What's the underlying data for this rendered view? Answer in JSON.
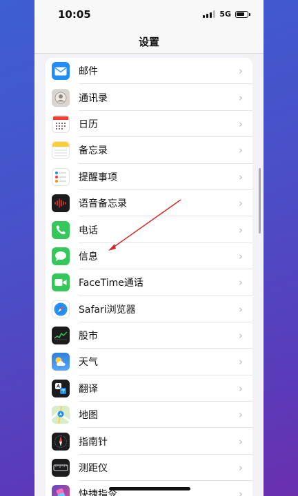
{
  "status_bar": {
    "time": "10:05",
    "network": "5G"
  },
  "nav": {
    "title": "设置"
  },
  "settings": {
    "items": [
      {
        "label": "邮件",
        "icon": "mail-icon",
        "color": "#1f8ef7"
      },
      {
        "label": "通讯录",
        "icon": "contacts-icon",
        "color": "#d9d6d1"
      },
      {
        "label": "日历",
        "icon": "calendar-icon",
        "color": "#ffffff"
      },
      {
        "label": "备忘录",
        "icon": "notes-icon",
        "color": "#ffcd35"
      },
      {
        "label": "提醒事项",
        "icon": "reminders-icon",
        "color": "#ffffff"
      },
      {
        "label": "语音备忘录",
        "icon": "voice-memos-icon",
        "color": "#1c1c1e"
      },
      {
        "label": "电话",
        "icon": "phone-icon",
        "color": "#34c759"
      },
      {
        "label": "信息",
        "icon": "messages-icon",
        "color": "#34c759"
      },
      {
        "label": "FaceTime通话",
        "icon": "facetime-icon",
        "color": "#34c759"
      },
      {
        "label": "Safari浏览器",
        "icon": "safari-icon",
        "color": "#1e8cf0"
      },
      {
        "label": "股市",
        "icon": "stocks-icon",
        "color": "#1c1c1e"
      },
      {
        "label": "天气",
        "icon": "weather-icon",
        "color": "#3a8ee6"
      },
      {
        "label": "翻译",
        "icon": "translate-icon",
        "color": "#1c1c1e"
      },
      {
        "label": "地图",
        "icon": "maps-icon",
        "color": "#e8f2e1"
      },
      {
        "label": "指南针",
        "icon": "compass-icon",
        "color": "#1c1c1e"
      },
      {
        "label": "测距仪",
        "icon": "measure-icon",
        "color": "#1c1c1e"
      },
      {
        "label": "快捷指令",
        "icon": "shortcuts-icon",
        "color": "#5b4ac7"
      }
    ]
  },
  "annotation": {
    "arrow_color": "#d32b2b"
  }
}
